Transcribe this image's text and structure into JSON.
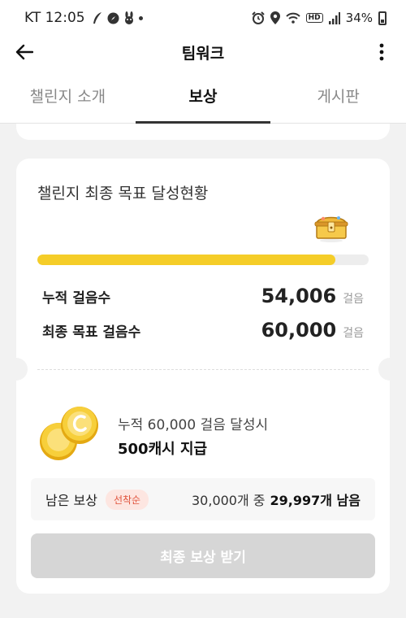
{
  "status_bar": {
    "carrier_time": "KT 12:05",
    "hd": "HD",
    "battery": "34%"
  },
  "header": {
    "title": "팀워크"
  },
  "tabs": [
    {
      "label": "챌린지 소개",
      "active": false
    },
    {
      "label": "보상",
      "active": true
    },
    {
      "label": "게시판",
      "active": false
    }
  ],
  "goal_card": {
    "title": "챌린지 최종 목표 달성현황",
    "progress_fraction": 0.9,
    "cumulative_label": "누적 걸음수",
    "cumulative_value": "54,006",
    "cumulative_unit": "걸음",
    "final_label": "최종 목표 걸음수",
    "final_value": "60,000",
    "final_unit": "걸음"
  },
  "reward": {
    "condition": "누적 60,000 걸음 달성시",
    "amount": "500캐시 지급",
    "remaining_label": "남은 보상",
    "badge": "선착순",
    "remaining_total": "30,000개 중",
    "remaining_count": "29,997개 남음",
    "claim_button": "최종 보상 받기"
  },
  "colors": {
    "accent_yellow": "#f5cd28",
    "badge_red": "#e0533b",
    "disabled_button": "#d6d6d6"
  }
}
